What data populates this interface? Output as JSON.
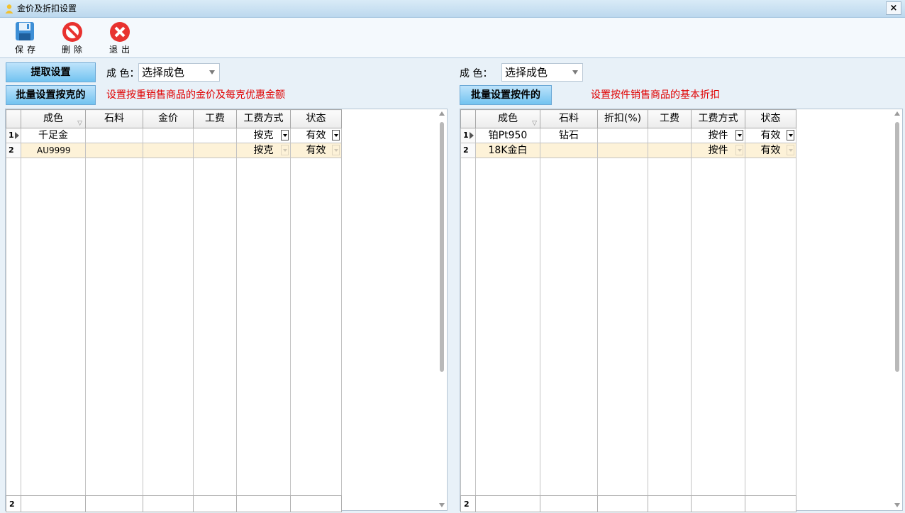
{
  "window": {
    "title": "金价及折扣设置",
    "close_glyph": "×",
    "title_icon": "person-icon"
  },
  "toolbar": {
    "save_label": "保存",
    "delete_label": "删除",
    "exit_label": "退出",
    "save_icon": "floppy-disk-icon",
    "delete_icon": "no-entry-icon",
    "exit_icon": "red-x-icon"
  },
  "left": {
    "fetch_button": "提取设置",
    "batch_button": "批量设置按克的",
    "color_label": "成 色：",
    "color_select": "选择成色",
    "hint": "设置按重销售商品的金价及每克优惠金额",
    "columns": [
      "成色",
      "石料",
      "金价",
      "工费",
      "工费方式",
      "状态"
    ],
    "rows": [
      {
        "num": "1",
        "color": "千足金",
        "stone": "",
        "price": "",
        "fee": "",
        "fee_mode": "按克",
        "status": "有效"
      },
      {
        "num": "2",
        "color": "AU9999",
        "stone": "",
        "price": "",
        "fee": "",
        "fee_mode": "按克",
        "status": "有效"
      }
    ],
    "footer_count": "2"
  },
  "right": {
    "color_label": "成 色：",
    "color_select": "选择成色",
    "batch_button": "批量设置按件的",
    "hint": "设置按件销售商品的基本折扣",
    "columns": [
      "成色",
      "石料",
      "折扣(%)",
      "工费",
      "工费方式",
      "状态"
    ],
    "rows": [
      {
        "num": "1",
        "color": "铂Pt950",
        "stone": "钻石",
        "discount": "",
        "fee": "",
        "fee_mode": "按件",
        "status": "有效"
      },
      {
        "num": "2",
        "color": "18K金白",
        "stone": "",
        "discount": "",
        "fee": "",
        "fee_mode": "按件",
        "status": "有效"
      }
    ],
    "footer_count": "2"
  },
  "colors": {
    "accent_button": "#72c3f0",
    "hint_text": "#e00000",
    "alt_row": "#fdf2d8"
  }
}
